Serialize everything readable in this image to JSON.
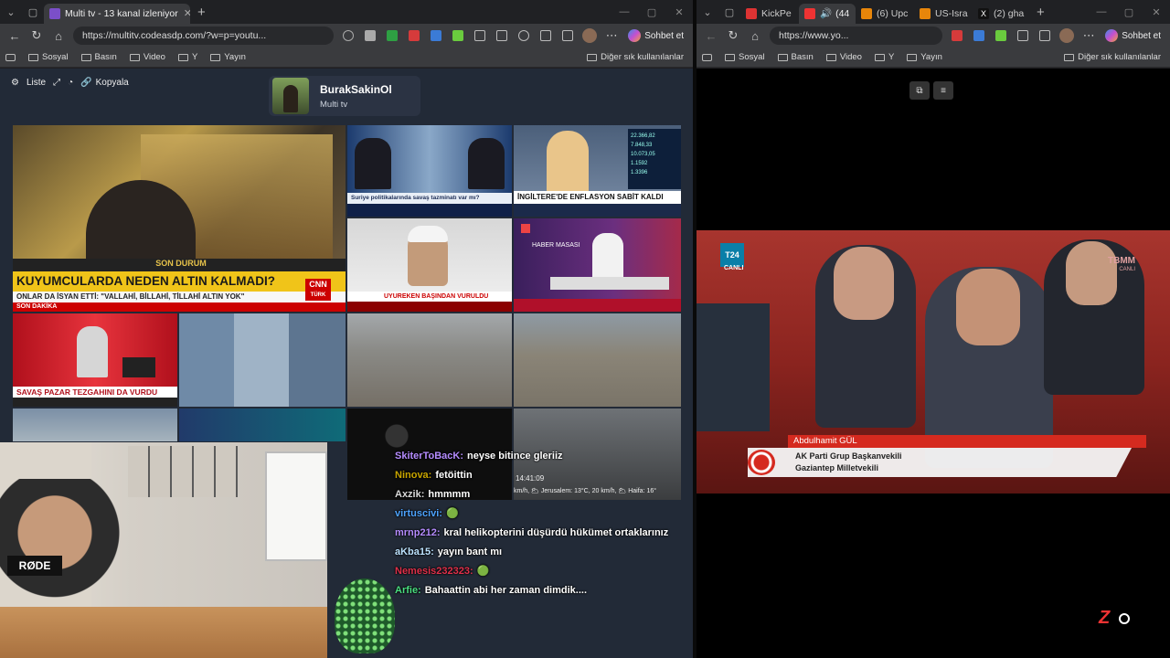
{
  "left_window": {
    "tabs": [
      {
        "title": "Multi tv - 13 kanal izleniyor",
        "active": true,
        "favicon_color": "#7b4fc9"
      }
    ],
    "url": "https://multitv.codeasdp.com/?w=p=youtu...",
    "copilot_label": "Sohbet et",
    "bookmarks": [
      "Sosyal",
      "Basın",
      "Video",
      "Y",
      "Yayın"
    ],
    "other_bookmarks": "Diğer sık kullanılanlar"
  },
  "right_window": {
    "tabs": [
      {
        "title": "KickPe",
        "favicon_color": "#d33"
      },
      {
        "title": "(44",
        "favicon_color": "#e33"
      },
      {
        "title": "(6) Upc",
        "favicon_color": "#e8860a"
      },
      {
        "title": "US-Isra",
        "favicon_color": "#e8860a"
      },
      {
        "title": "(2) gha",
        "favicon_color": "#111"
      }
    ],
    "url": "https://www.yo...",
    "copilot_label": "Sohbet et",
    "bookmarks": [
      "Sosyal",
      "Basın",
      "Video",
      "Y",
      "Yayın"
    ],
    "other_bookmarks": "Diğer sık kullanılanlar"
  },
  "multitv": {
    "toolbar": {
      "list_label": "Liste",
      "copy_label": "Kopyala"
    },
    "channel": {
      "name": "BurakSakinOl",
      "subtitle": "Multi tv"
    },
    "tiles": {
      "cnn": {
        "tag": "SON DURUM",
        "headline": "KUYUMCULARDA NEDEN ALTIN KALMADI?",
        "sub": "ONLAR DA İSYAN ETTİ: \"VALLAHİ, BİLLAHİ, TİLLAHİ ALTIN YOK\"",
        "ticker": "SON DAKİKA",
        "logo": "CNN",
        "logo_sub": "TÜRK"
      },
      "debate": {
        "caption": "Suriye politikalarında savaş tazminatı var mı?"
      },
      "uk": {
        "headline": "İNGİLTERE'DE ENFLASYON SABİT KALDI",
        "values": [
          "22.366,82",
          "7.848,33",
          "10.073,05",
          "1.1592",
          "1.3396"
        ]
      },
      "injured": {
        "headline": "UYUREKEN BAŞINDAN VURULDU"
      },
      "haber": {
        "logo": "HABER MASASI"
      },
      "sozcu": {
        "headline": "SAVAŞ PAZAR TEZGAHINI DA VURDU"
      },
      "weather": {
        "time": "14:41:09",
        "info": "km/h, 🌥 Jerusalem: 13°C, 20 km/h, 🌥 Haifa: 16°"
      }
    },
    "chat": [
      {
        "user": "SkiterToBacK:",
        "text": "neyse bitince gleriiz",
        "color": "#b58cff"
      },
      {
        "user": "Ninova:",
        "text": "fetöittin",
        "color": "#c8a500"
      },
      {
        "user": "Axzik:",
        "text": "hmmmm",
        "color": "#d8d8d8"
      },
      {
        "user": "virtuscivi:",
        "text": "🟢",
        "color": "#4da3ff"
      },
      {
        "user": "mrnp212:",
        "text": "kral helikopterini düşürdü hükümet ortaklarınız",
        "color": "#b58cff"
      },
      {
        "user": "aKba15:",
        "text": "yayın bant mı",
        "color": "#bde3ff"
      },
      {
        "user": "Nemesis232323:",
        "text": "🟢",
        "color": "#e0304a"
      },
      {
        "user": "Arfie:",
        "text": "Bahaattin abi her zaman dimdik....",
        "color": "#4ade80"
      }
    ]
  },
  "parliament": {
    "channel_logo": "T24",
    "live": "CANLI",
    "corner_logo": "TBMM",
    "corner_live": "CANLI",
    "person_name": "Abdulhamit GÜL",
    "role_line1": "AK Parti Grup Başkanvekili",
    "role_line2": "Gaziantep Milletvekili",
    "watermark": "Z"
  }
}
